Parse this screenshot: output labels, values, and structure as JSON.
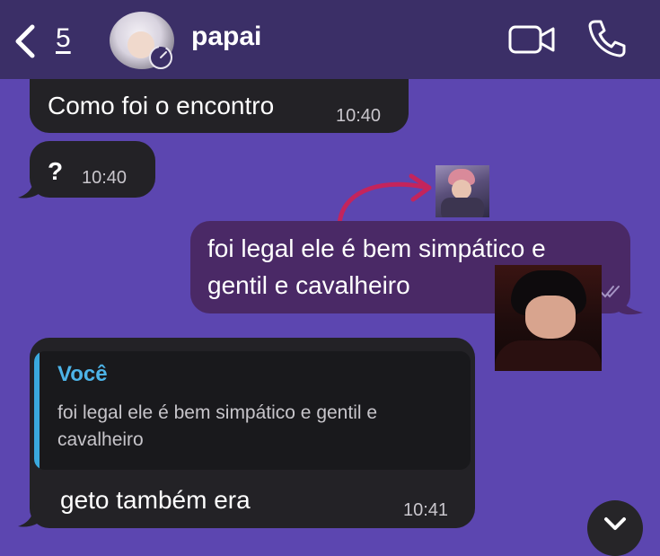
{
  "header": {
    "back_count": "5",
    "contact_name": "papai"
  },
  "messages": [
    {
      "direction": "incoming",
      "text": "Como foi o encontro",
      "time": "10:40"
    },
    {
      "direction": "incoming",
      "text": "?",
      "time": "10:40"
    },
    {
      "direction": "outgoing",
      "lines": [
        "foi legal ele é bem simpático e",
        "gentil e cavalheiro"
      ]
    },
    {
      "direction": "incoming",
      "reply": {
        "author": "Você",
        "text": "foi legal ele é bem simpático e gentil e cavalheiro"
      },
      "text": "geto também era",
      "time": "10:41"
    }
  ],
  "icons": {
    "back": "chevron-left-icon",
    "timer": "timer-icon",
    "video": "video-camera-icon",
    "phone": "phone-icon",
    "scroll": "chevron-down-icon"
  },
  "colors": {
    "header_bg": "#3b2f67",
    "chat_bg": "#5c46b0",
    "incoming_bubble": "#232226",
    "outgoing_bubble": "#4a2966",
    "reply_accent": "#4db4e8",
    "arrow": "#c4245c"
  }
}
